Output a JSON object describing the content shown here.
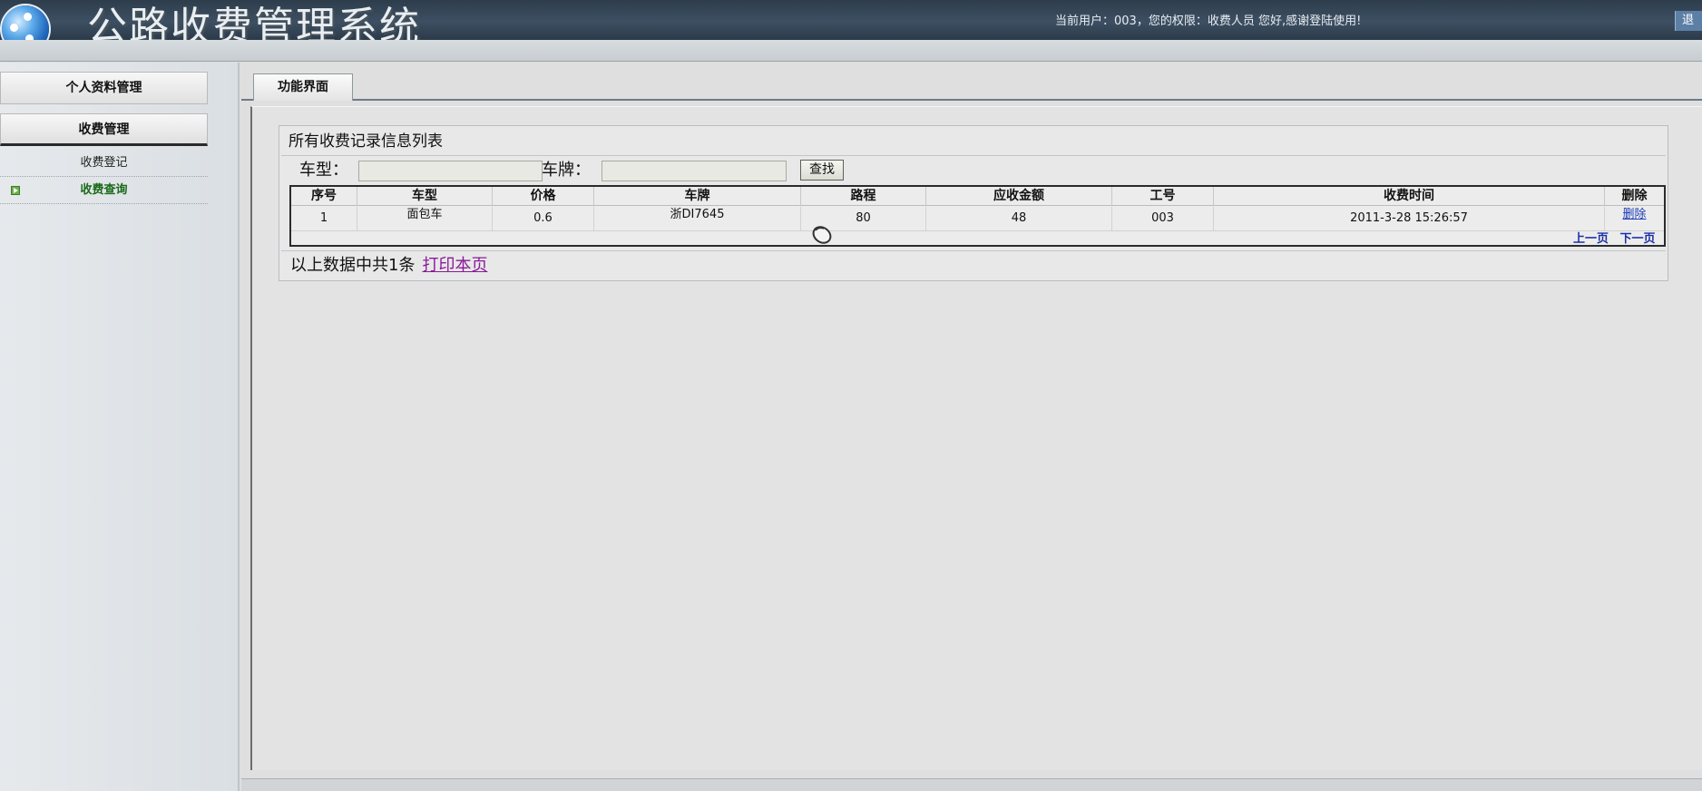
{
  "app": {
    "title": "公路收费管理系统",
    "user_info": "当前用户：003，您的权限：收费人员 您好,感谢登陆使用!",
    "logout_label": "退"
  },
  "sidebar": {
    "profile": "个人资料管理",
    "toll_management": "收费管理",
    "sub_items": [
      "收费登记",
      "收费查询"
    ]
  },
  "tabs": {
    "function": "功能界面"
  },
  "list": {
    "title": "所有收费记录信息列表",
    "search": {
      "type_label": "车型：",
      "type_value": "",
      "plate_label": "车牌：",
      "plate_value": "",
      "button": "查找"
    },
    "columns": [
      "序号",
      "车型",
      "价格",
      "车牌",
      "路程",
      "应收金额",
      "工号",
      "收费时间",
      "删除"
    ],
    "rows": [
      [
        "1",
        "面包车",
        "0.6",
        "浙DI7645",
        "80",
        "48",
        "003",
        "2011-3-28 15:26:57",
        "删除"
      ]
    ],
    "pager": {
      "prev": "上一页",
      "next": "下一页"
    },
    "summary": "以上数据中共1条",
    "print": "打印本页"
  }
}
